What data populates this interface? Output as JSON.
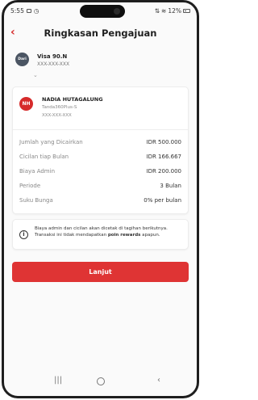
{
  "status": {
    "time": "5:55",
    "right_text": "12%"
  },
  "header": {
    "title": "Ringkasan Pengajuan"
  },
  "source": {
    "avatar_text": "Dari",
    "name": "Visa 90.N",
    "number": "XXX-XXX-XXX"
  },
  "recipient": {
    "initials": "NH",
    "name": "NADIA HUTAGALUNG",
    "subtitle": "Tanda360Plus-S",
    "number": "XXX-XXX-XXX"
  },
  "details": [
    {
      "label": "Jumlah yang Dicairkan",
      "value": "IDR 500.000"
    },
    {
      "label": "Cicilan tiap Bulan",
      "value": "IDR 166.667"
    },
    {
      "label": "Biaya Admin",
      "value": "IDR 200.000"
    },
    {
      "label": "Periode",
      "value": "3 Bulan"
    },
    {
      "label": "Suku Bunga",
      "value": "0% per bulan"
    }
  ],
  "notice": {
    "text": "Biaya admin dan cicilan akan dicetak di tagihan berikutnya. Transaksi ini tidak mendapatkan ",
    "bold": "poin rewards",
    "tail": " apapun."
  },
  "actions": {
    "primary_label": "Lanjut"
  },
  "theme": {
    "accent": "#df3434",
    "dark_avatar": "#4b5563"
  },
  "icons": {
    "back": "chevron-left-icon",
    "info": "info-icon"
  }
}
